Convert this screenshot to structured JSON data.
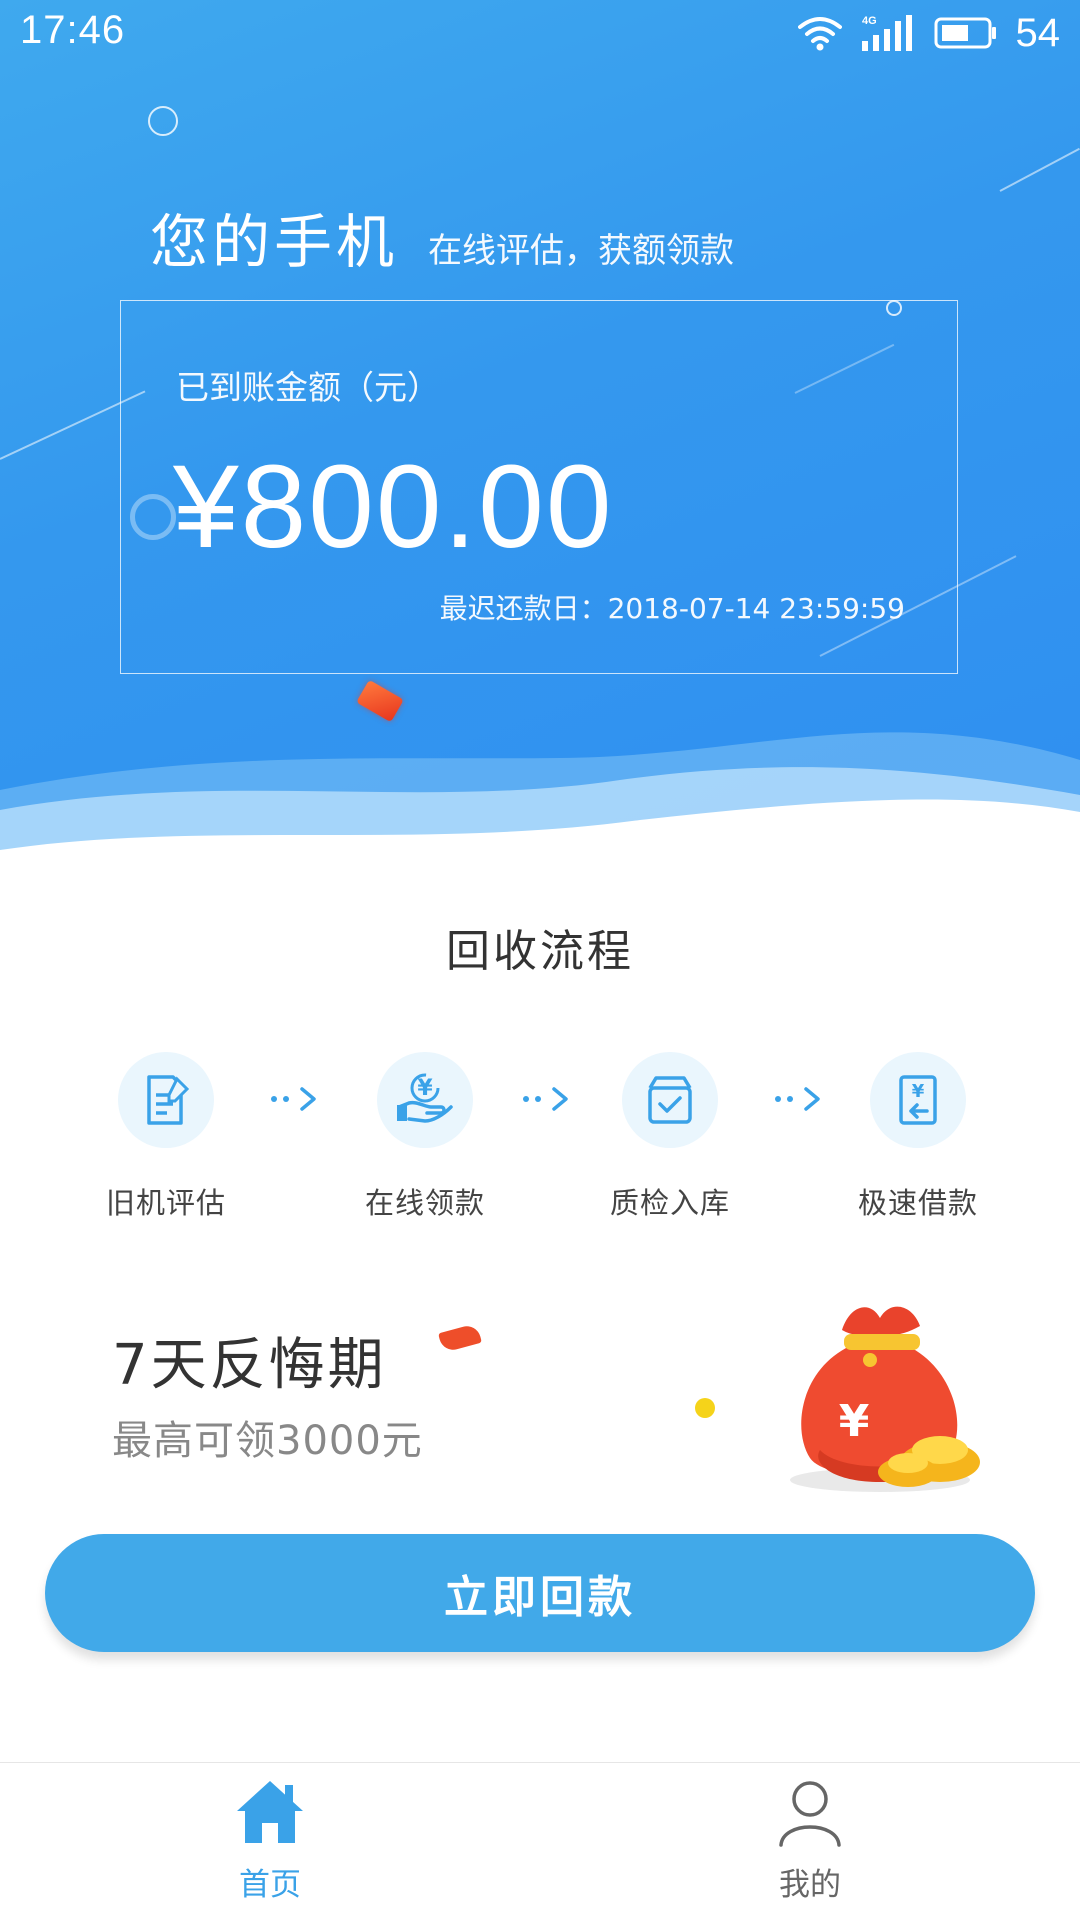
{
  "status_bar": {
    "time": "17:46",
    "network": "4G",
    "battery": "54"
  },
  "header": {
    "title": "您的手机",
    "subtitle": "在线评估，获额领款"
  },
  "amount_card": {
    "label": "已到账金额（元）",
    "amount": "¥800.00",
    "due_label": "最迟还款日：",
    "due_date": "2018-07-14 23:59:59"
  },
  "process": {
    "title": "回收流程",
    "steps": [
      {
        "label": "旧机评估",
        "icon": "document-edit-icon"
      },
      {
        "label": "在线领款",
        "icon": "hand-money-icon"
      },
      {
        "label": "质检入库",
        "icon": "box-check-icon"
      },
      {
        "label": "极速借款",
        "icon": "receipt-return-icon"
      }
    ]
  },
  "promo": {
    "title": "7天反悔期",
    "subtitle": "最高可领3000元",
    "bag_symbol": "¥"
  },
  "cta": {
    "label": "立即回款"
  },
  "tabs": [
    {
      "label": "首页",
      "icon": "home-icon",
      "active": true
    },
    {
      "label": "我的",
      "icon": "user-icon",
      "active": false
    }
  ],
  "colors": {
    "primary": "#3aa2e8",
    "header_gradient_start": "#3fa9ee",
    "header_gradient_end": "#2f8ff1",
    "step_circle_bg": "#eaf6fd",
    "text_dark": "#333333",
    "text_muted": "#888888"
  }
}
